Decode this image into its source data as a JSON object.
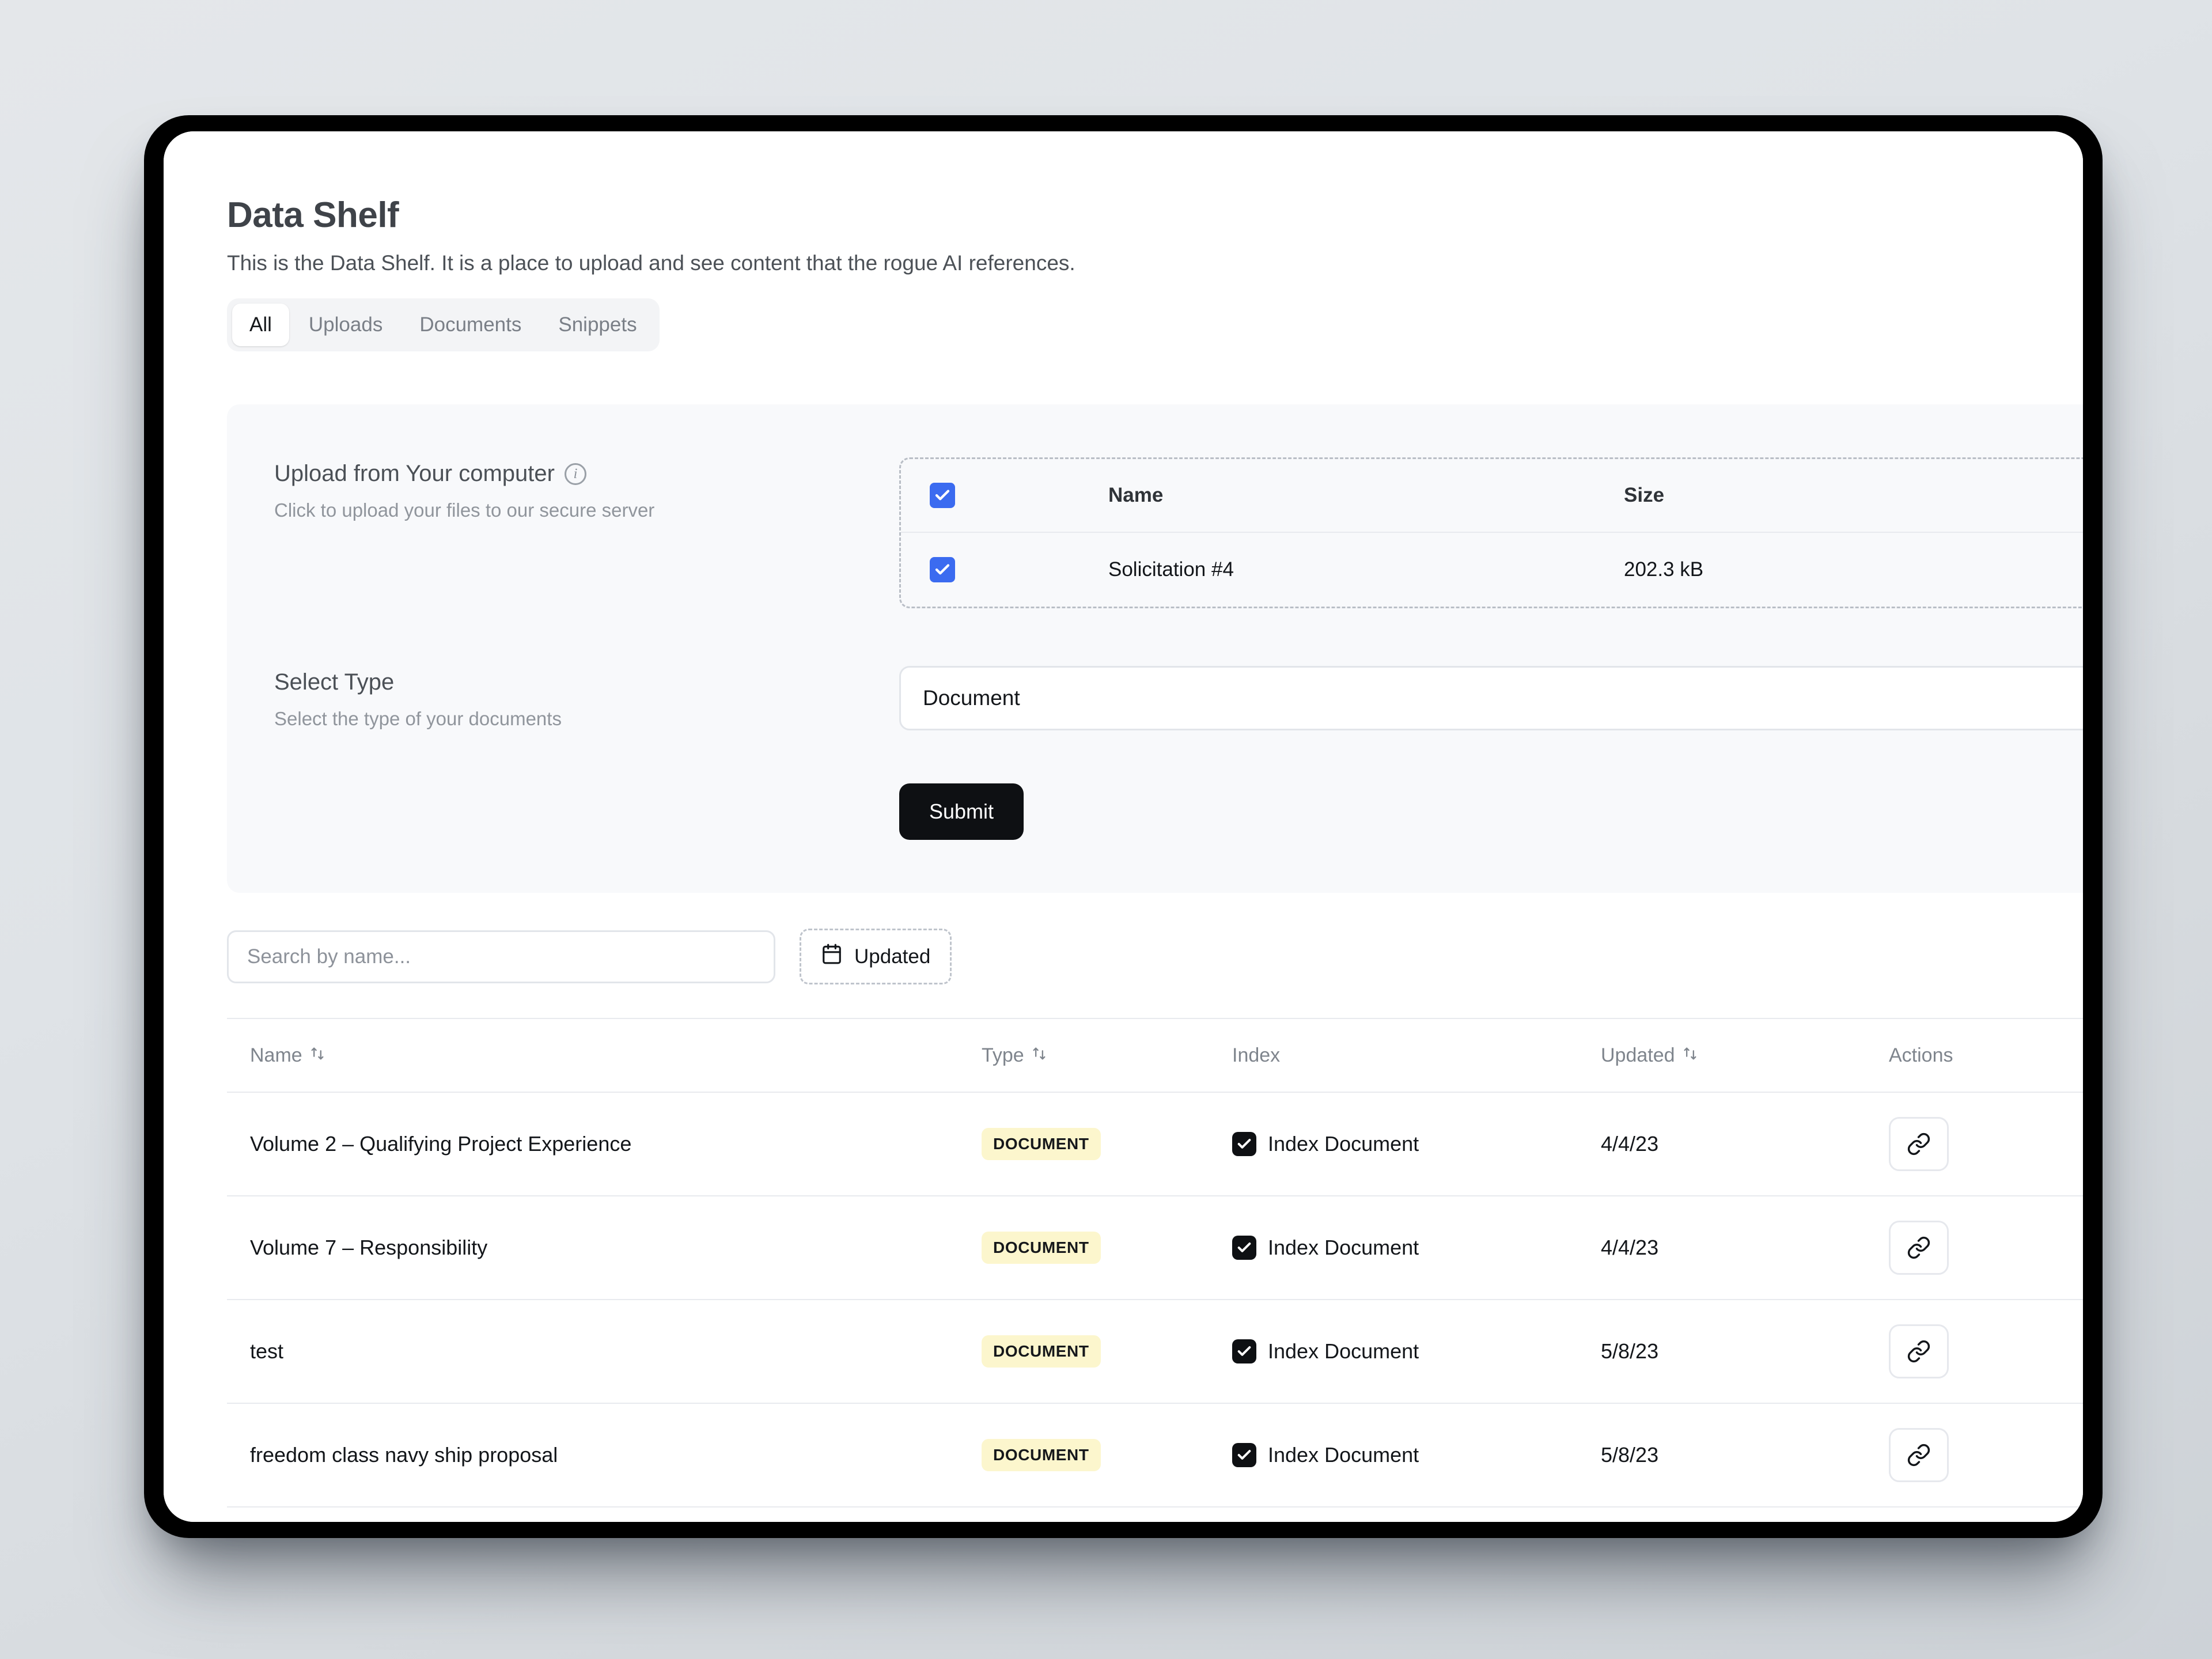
{
  "page": {
    "title": "Data Shelf",
    "subtitle": "This is the Data Shelf. It is a place to upload and see content that the rogue AI references."
  },
  "tabs": [
    {
      "label": "All",
      "active": true
    },
    {
      "label": "Uploads",
      "active": false
    },
    {
      "label": "Documents",
      "active": false
    },
    {
      "label": "Snippets",
      "active": false
    }
  ],
  "upload_section": {
    "upload_label": "Upload from Your computer",
    "upload_desc": "Click to upload your files to our secure server",
    "info_icon": "info-circle-icon",
    "files_table": {
      "columns": [
        "Name",
        "Size"
      ],
      "select_all_checked": true,
      "rows": [
        {
          "name": "Solicitation #4",
          "size": "202.3 kB",
          "checked": true
        }
      ]
    },
    "select_type_label": "Select Type",
    "select_type_desc": "Select the type of your documents",
    "select_type_value": "Document",
    "select_chevron_icon": "chevron-down-icon",
    "submit_label": "Submit"
  },
  "filters": {
    "search_placeholder": "Search by name...",
    "search_value": "",
    "updated_chip_label": "Updated",
    "updated_chip_icon": "calendar-icon"
  },
  "table": {
    "headers": {
      "name": "Name",
      "type": "Type",
      "index": "Index",
      "updated": "Updated",
      "actions": "Actions"
    },
    "sort_icon": "sort-updown-icon",
    "link_icon": "link-chain-icon",
    "rows": [
      {
        "name": "Volume 2 – Qualifying Project Experience",
        "type": "DOCUMENT",
        "index_label": "Index Document",
        "index_checked": true,
        "updated": "4/4/23"
      },
      {
        "name": "Volume 7 – Responsibility",
        "type": "DOCUMENT",
        "index_label": "Index Document",
        "index_checked": true,
        "updated": "4/4/23"
      },
      {
        "name": "test",
        "type": "DOCUMENT",
        "index_label": "Index Document",
        "index_checked": true,
        "updated": "5/8/23"
      },
      {
        "name": "freedom class navy ship proposal",
        "type": "DOCUMENT",
        "index_label": "Index Document",
        "index_checked": true,
        "updated": "5/8/23"
      }
    ]
  },
  "colors": {
    "checkbox_blue": "#3b6bf0",
    "badge_yellow": "#fcf6cd",
    "submit_black": "#0e1013",
    "panel_gray": "#f8f9fb",
    "frame_black": "#000000"
  }
}
